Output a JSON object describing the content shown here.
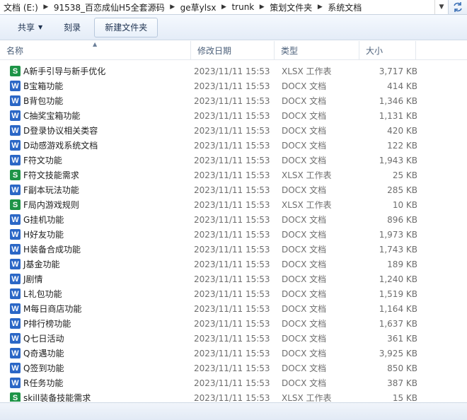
{
  "address": {
    "crumbs": [
      "文档 (E:)",
      "91538_百恋成仙H5全套源码",
      "ge草ylsx",
      "trunk",
      "策划文件夹",
      "系统文档"
    ]
  },
  "toolbar": {
    "share_label": "共享",
    "burn_label": "刻录",
    "new_folder_label": "新建文件夹"
  },
  "columns": {
    "name": "名称",
    "date": "修改日期",
    "type": "类型",
    "size": "大小"
  },
  "files": [
    {
      "icon": "S",
      "name": "A新手引导与新手优化",
      "date": "2023/11/11 15:53",
      "type": "XLSX 工作表",
      "size": "3,717 KB"
    },
    {
      "icon": "W",
      "name": "B宝箱功能",
      "date": "2023/11/11 15:53",
      "type": "DOCX 文档",
      "size": "414 KB"
    },
    {
      "icon": "W",
      "name": "B背包功能",
      "date": "2023/11/11 15:53",
      "type": "DOCX 文档",
      "size": "1,346 KB"
    },
    {
      "icon": "W",
      "name": "C抽奖宝箱功能",
      "date": "2023/11/11 15:53",
      "type": "DOCX 文档",
      "size": "1,131 KB"
    },
    {
      "icon": "W",
      "name": "D登录协议相关类容",
      "date": "2023/11/11 15:53",
      "type": "DOCX 文档",
      "size": "420 KB"
    },
    {
      "icon": "W",
      "name": "D动感游戏系统文档",
      "date": "2023/11/11 15:53",
      "type": "DOCX 文档",
      "size": "122 KB"
    },
    {
      "icon": "W",
      "name": "F符文功能",
      "date": "2023/11/11 15:53",
      "type": "DOCX 文档",
      "size": "1,943 KB"
    },
    {
      "icon": "S",
      "name": "F符文技能需求",
      "date": "2023/11/11 15:53",
      "type": "XLSX 工作表",
      "size": "25 KB"
    },
    {
      "icon": "W",
      "name": "F副本玩法功能",
      "date": "2023/11/11 15:53",
      "type": "DOCX 文档",
      "size": "285 KB"
    },
    {
      "icon": "S",
      "name": "F局内游戏规则",
      "date": "2023/11/11 15:53",
      "type": "XLSX 工作表",
      "size": "10 KB"
    },
    {
      "icon": "W",
      "name": "G挂机功能",
      "date": "2023/11/11 15:53",
      "type": "DOCX 文档",
      "size": "896 KB"
    },
    {
      "icon": "W",
      "name": "H好友功能",
      "date": "2023/11/11 15:53",
      "type": "DOCX 文档",
      "size": "1,973 KB"
    },
    {
      "icon": "W",
      "name": "H装备合成功能",
      "date": "2023/11/11 15:53",
      "type": "DOCX 文档",
      "size": "1,743 KB"
    },
    {
      "icon": "W",
      "name": "J基金功能",
      "date": "2023/11/11 15:53",
      "type": "DOCX 文档",
      "size": "189 KB"
    },
    {
      "icon": "W",
      "name": "J剧情",
      "date": "2023/11/11 15:53",
      "type": "DOCX 文档",
      "size": "1,240 KB"
    },
    {
      "icon": "W",
      "name": "L礼包功能",
      "date": "2023/11/11 15:53",
      "type": "DOCX 文档",
      "size": "1,519 KB"
    },
    {
      "icon": "W",
      "name": "M每日商店功能",
      "date": "2023/11/11 15:53",
      "type": "DOCX 文档",
      "size": "1,164 KB"
    },
    {
      "icon": "W",
      "name": "P排行榜功能",
      "date": "2023/11/11 15:53",
      "type": "DOCX 文档",
      "size": "1,637 KB"
    },
    {
      "icon": "W",
      "name": "Q七日活动",
      "date": "2023/11/11 15:53",
      "type": "DOCX 文档",
      "size": "361 KB"
    },
    {
      "icon": "W",
      "name": "Q奇遇功能",
      "date": "2023/11/11 15:53",
      "type": "DOCX 文档",
      "size": "3,925 KB"
    },
    {
      "icon": "W",
      "name": "Q签到功能",
      "date": "2023/11/11 15:53",
      "type": "DOCX 文档",
      "size": "850 KB"
    },
    {
      "icon": "W",
      "name": "R任务功能",
      "date": "2023/11/11 15:53",
      "type": "DOCX 文档",
      "size": "387 KB"
    },
    {
      "icon": "S",
      "name": "skill装备技能需求",
      "date": "2023/11/11 15:53",
      "type": "XLSX 工作表",
      "size": "15 KB"
    }
  ]
}
